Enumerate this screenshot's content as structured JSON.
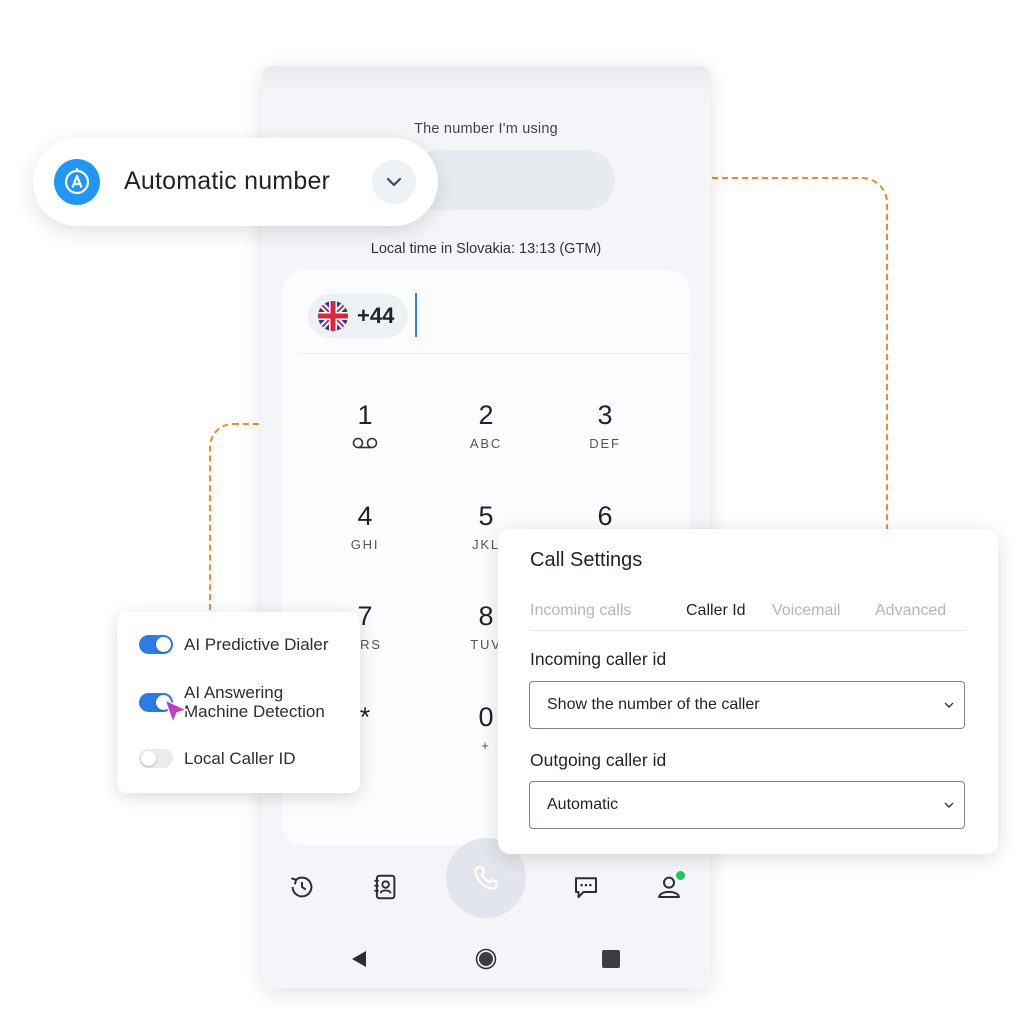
{
  "header_pill": {
    "label": "Automatic number",
    "icon": "auto-a-icon",
    "dropdown_icon": "chevron-down-icon",
    "accent_color": "#2196f3"
  },
  "phone": {
    "number_label": "The number I'm using",
    "local_time": "Local time in Slovakia: 13:13 (GTM)",
    "country": {
      "flag": "uk-flag-icon",
      "code": "+44"
    },
    "keypad": [
      {
        "digit": "1",
        "letters": "",
        "icon": "voicemail-icon"
      },
      {
        "digit": "2",
        "letters": "ABC"
      },
      {
        "digit": "3",
        "letters": "DEF"
      },
      {
        "digit": "4",
        "letters": "GHI"
      },
      {
        "digit": "5",
        "letters": "JKL"
      },
      {
        "digit": "6",
        "letters": ""
      },
      {
        "digit": "7",
        "letters": "QRS"
      },
      {
        "digit": "8",
        "letters": "TUV"
      },
      {
        "digit": "*",
        "letters": ""
      },
      {
        "digit": "0",
        "letters": "+"
      }
    ],
    "bottom_nav": [
      "history-icon",
      "contacts-icon",
      "phone-icon",
      "chat-icon",
      "profile-icon"
    ],
    "system_nav": [
      "back-icon",
      "home-icon",
      "recents-icon"
    ]
  },
  "toggles": [
    {
      "label": "AI Predictive Dialer",
      "on": true
    },
    {
      "label": "AI Answering Machine Detection",
      "line1": "AI Answering",
      "line2": "Machine Detection",
      "on": true
    },
    {
      "label": "Local Caller ID",
      "on": false
    }
  ],
  "call_settings": {
    "title": "Call Settings",
    "tabs": [
      {
        "label": "Incoming calls",
        "active": false
      },
      {
        "label": "Caller Id",
        "active": true
      },
      {
        "label": "Voicemail",
        "active": false
      },
      {
        "label": "Advanced",
        "active": false
      }
    ],
    "incoming_label": "Incoming caller id",
    "incoming_value": "Show the number of the caller",
    "outgoing_label": "Outgoing caller id",
    "outgoing_value": "Automatic"
  },
  "colors": {
    "connector": "#f08a2c",
    "toggle_on": "#2d7be5",
    "online": "#22c55e"
  }
}
